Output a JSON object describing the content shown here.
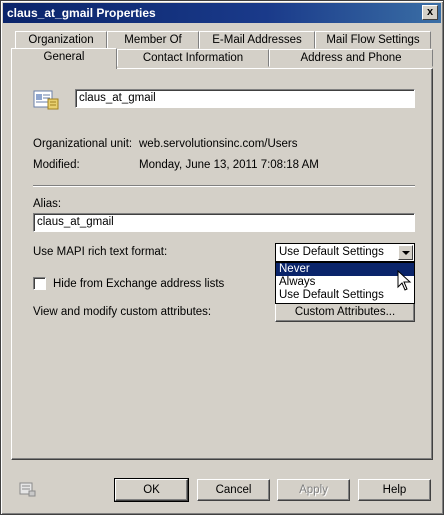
{
  "window": {
    "title": "claus_at_gmail Properties",
    "close_glyph": "x"
  },
  "tabs_back": [
    {
      "label": "Organization"
    },
    {
      "label": "Member Of"
    },
    {
      "label": "E-Mail Addresses"
    },
    {
      "label": "Mail Flow Settings"
    }
  ],
  "tabs_front": [
    {
      "label": "General",
      "active": true
    },
    {
      "label": "Contact Information"
    },
    {
      "label": "Address and Phone"
    }
  ],
  "general": {
    "display_name": "claus_at_gmail",
    "org_unit_label": "Organizational unit:",
    "org_unit_value": "web.servolutionsinc.com/Users",
    "modified_label": "Modified:",
    "modified_value": "Monday, June 13, 2011 7:08:18 AM",
    "alias_label": "Alias:",
    "alias_value": "claus_at_gmail",
    "mapi_label": "Use MAPI rich text format:",
    "mapi_selected": "Use Default Settings",
    "mapi_options": [
      "Never",
      "Always",
      "Use Default Settings"
    ],
    "hide_label": "Hide from Exchange address lists",
    "hide_checked": false,
    "custom_attr_label": "View and modify custom attributes:",
    "custom_attr_button": "Custom Attributes..."
  },
  "buttons": {
    "ok": "OK",
    "cancel": "Cancel",
    "apply": "Apply",
    "help": "Help"
  }
}
